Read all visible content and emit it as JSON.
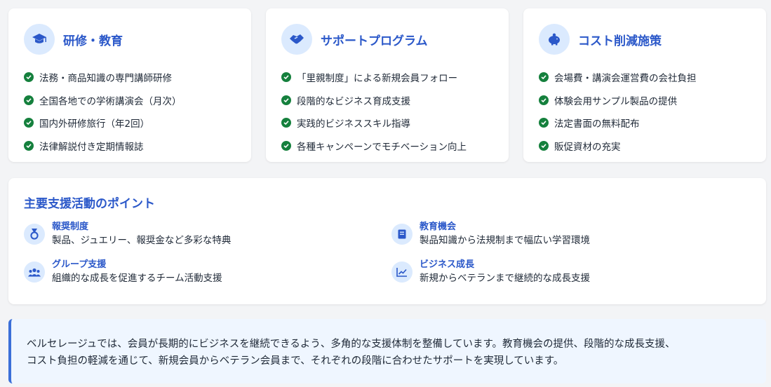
{
  "cards": [
    {
      "title": "研修・教育",
      "icon": "graduation-cap-icon",
      "items": [
        "法務・商品知識の専門講師研修",
        "全国各地での学術講演会（月次）",
        "国内外研修旅行（年2回）",
        "法律解説付き定期情報誌"
      ]
    },
    {
      "title": "サポートプログラム",
      "icon": "handshake-icon",
      "items": [
        "「里親制度」による新規会員フォロー",
        "段階的なビジネス育成支援",
        "実践的ビジネススキル指導",
        "各種キャンペーンでモチベーション向上"
      ]
    },
    {
      "title": "コスト削減施策",
      "icon": "piggy-bank-icon",
      "items": [
        "会場費・講演会運営費の会社負担",
        "体験会用サンプル製品の提供",
        "法定書面の無料配布",
        "販促資材の充実"
      ]
    }
  ],
  "points": {
    "title": "主要支援活動のポイント",
    "items": [
      {
        "title": "報奨制度",
        "desc": "製品、ジュエリー、報奨金など多彩な特典",
        "icon": "medal-icon"
      },
      {
        "title": "教育機会",
        "desc": "製品知識から法規制まで幅広い学習環境",
        "icon": "book-icon"
      },
      {
        "title": "グループ支援",
        "desc": "組織的な成長を促進するチーム活動支援",
        "icon": "users-icon"
      },
      {
        "title": "ビジネス成長",
        "desc": "新規からベテランまで継続的な成長支援",
        "icon": "chart-line-icon"
      }
    ]
  },
  "note": {
    "line1": "ベルセレージュでは、会員が長期的にビジネスを継続できるよう、多角的な支援体制を整備しています。教育機会の提供、段階的な成長支援、",
    "line2": "コスト負担の軽減を通じて、新規会員からベテラン会員まで、それぞれの段階に合わせたサポートを実現しています。"
  },
  "colors": {
    "accent": "#2b58c9",
    "check": "#15803d",
    "icon_bg": "#dbeafe",
    "note_bg": "#eff6ff"
  }
}
